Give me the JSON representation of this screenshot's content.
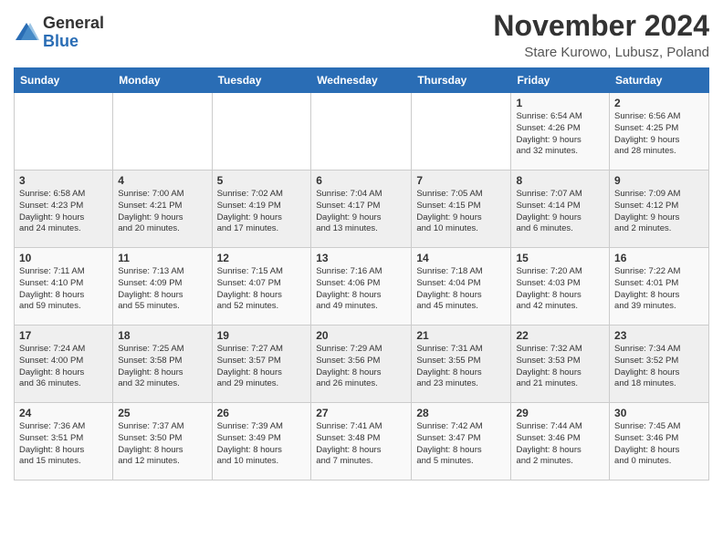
{
  "logo": {
    "general": "General",
    "blue": "Blue"
  },
  "title": "November 2024",
  "location": "Stare Kurowo, Lubusz, Poland",
  "weekdays": [
    "Sunday",
    "Monday",
    "Tuesday",
    "Wednesday",
    "Thursday",
    "Friday",
    "Saturday"
  ],
  "weeks": [
    [
      {
        "day": "",
        "detail": ""
      },
      {
        "day": "",
        "detail": ""
      },
      {
        "day": "",
        "detail": ""
      },
      {
        "day": "",
        "detail": ""
      },
      {
        "day": "",
        "detail": ""
      },
      {
        "day": "1",
        "detail": "Sunrise: 6:54 AM\nSunset: 4:26 PM\nDaylight: 9 hours\nand 32 minutes."
      },
      {
        "day": "2",
        "detail": "Sunrise: 6:56 AM\nSunset: 4:25 PM\nDaylight: 9 hours\nand 28 minutes."
      }
    ],
    [
      {
        "day": "3",
        "detail": "Sunrise: 6:58 AM\nSunset: 4:23 PM\nDaylight: 9 hours\nand 24 minutes."
      },
      {
        "day": "4",
        "detail": "Sunrise: 7:00 AM\nSunset: 4:21 PM\nDaylight: 9 hours\nand 20 minutes."
      },
      {
        "day": "5",
        "detail": "Sunrise: 7:02 AM\nSunset: 4:19 PM\nDaylight: 9 hours\nand 17 minutes."
      },
      {
        "day": "6",
        "detail": "Sunrise: 7:04 AM\nSunset: 4:17 PM\nDaylight: 9 hours\nand 13 minutes."
      },
      {
        "day": "7",
        "detail": "Sunrise: 7:05 AM\nSunset: 4:15 PM\nDaylight: 9 hours\nand 10 minutes."
      },
      {
        "day": "8",
        "detail": "Sunrise: 7:07 AM\nSunset: 4:14 PM\nDaylight: 9 hours\nand 6 minutes."
      },
      {
        "day": "9",
        "detail": "Sunrise: 7:09 AM\nSunset: 4:12 PM\nDaylight: 9 hours\nand 2 minutes."
      }
    ],
    [
      {
        "day": "10",
        "detail": "Sunrise: 7:11 AM\nSunset: 4:10 PM\nDaylight: 8 hours\nand 59 minutes."
      },
      {
        "day": "11",
        "detail": "Sunrise: 7:13 AM\nSunset: 4:09 PM\nDaylight: 8 hours\nand 55 minutes."
      },
      {
        "day": "12",
        "detail": "Sunrise: 7:15 AM\nSunset: 4:07 PM\nDaylight: 8 hours\nand 52 minutes."
      },
      {
        "day": "13",
        "detail": "Sunrise: 7:16 AM\nSunset: 4:06 PM\nDaylight: 8 hours\nand 49 minutes."
      },
      {
        "day": "14",
        "detail": "Sunrise: 7:18 AM\nSunset: 4:04 PM\nDaylight: 8 hours\nand 45 minutes."
      },
      {
        "day": "15",
        "detail": "Sunrise: 7:20 AM\nSunset: 4:03 PM\nDaylight: 8 hours\nand 42 minutes."
      },
      {
        "day": "16",
        "detail": "Sunrise: 7:22 AM\nSunset: 4:01 PM\nDaylight: 8 hours\nand 39 minutes."
      }
    ],
    [
      {
        "day": "17",
        "detail": "Sunrise: 7:24 AM\nSunset: 4:00 PM\nDaylight: 8 hours\nand 36 minutes."
      },
      {
        "day": "18",
        "detail": "Sunrise: 7:25 AM\nSunset: 3:58 PM\nDaylight: 8 hours\nand 32 minutes."
      },
      {
        "day": "19",
        "detail": "Sunrise: 7:27 AM\nSunset: 3:57 PM\nDaylight: 8 hours\nand 29 minutes."
      },
      {
        "day": "20",
        "detail": "Sunrise: 7:29 AM\nSunset: 3:56 PM\nDaylight: 8 hours\nand 26 minutes."
      },
      {
        "day": "21",
        "detail": "Sunrise: 7:31 AM\nSunset: 3:55 PM\nDaylight: 8 hours\nand 23 minutes."
      },
      {
        "day": "22",
        "detail": "Sunrise: 7:32 AM\nSunset: 3:53 PM\nDaylight: 8 hours\nand 21 minutes."
      },
      {
        "day": "23",
        "detail": "Sunrise: 7:34 AM\nSunset: 3:52 PM\nDaylight: 8 hours\nand 18 minutes."
      }
    ],
    [
      {
        "day": "24",
        "detail": "Sunrise: 7:36 AM\nSunset: 3:51 PM\nDaylight: 8 hours\nand 15 minutes."
      },
      {
        "day": "25",
        "detail": "Sunrise: 7:37 AM\nSunset: 3:50 PM\nDaylight: 8 hours\nand 12 minutes."
      },
      {
        "day": "26",
        "detail": "Sunrise: 7:39 AM\nSunset: 3:49 PM\nDaylight: 8 hours\nand 10 minutes."
      },
      {
        "day": "27",
        "detail": "Sunrise: 7:41 AM\nSunset: 3:48 PM\nDaylight: 8 hours\nand 7 minutes."
      },
      {
        "day": "28",
        "detail": "Sunrise: 7:42 AM\nSunset: 3:47 PM\nDaylight: 8 hours\nand 5 minutes."
      },
      {
        "day": "29",
        "detail": "Sunrise: 7:44 AM\nSunset: 3:46 PM\nDaylight: 8 hours\nand 2 minutes."
      },
      {
        "day": "30",
        "detail": "Sunrise: 7:45 AM\nSunset: 3:46 PM\nDaylight: 8 hours\nand 0 minutes."
      }
    ]
  ]
}
